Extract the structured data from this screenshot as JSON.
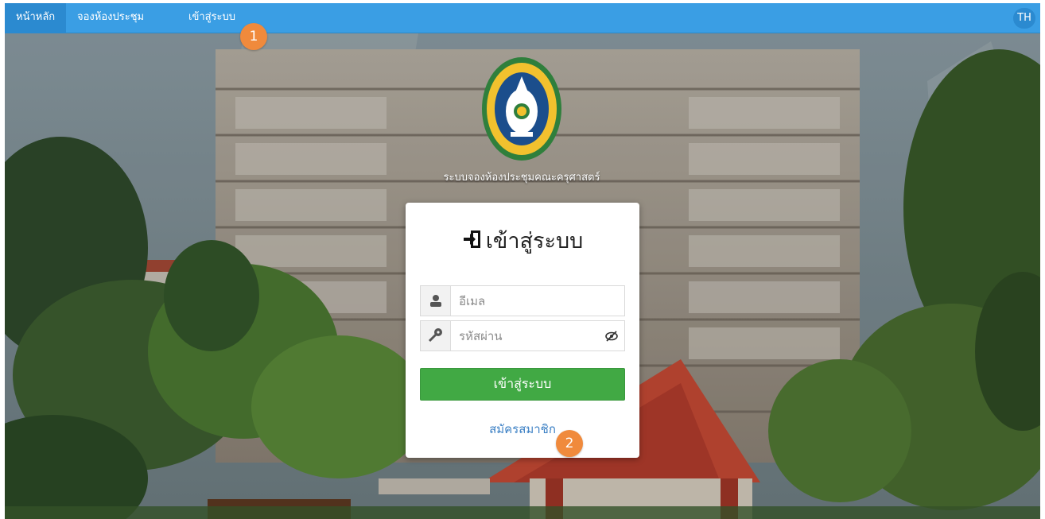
{
  "navbar": {
    "items": [
      {
        "label": "หน้าหลัก"
      },
      {
        "label": "จองห้องประชุม"
      },
      {
        "label": "เข้าสู่ระบบ"
      }
    ],
    "language": "TH"
  },
  "annotations": [
    {
      "number": "1"
    },
    {
      "number": "2"
    }
  ],
  "system_title": "ระบบจองห้องประชุมคณะครุศาสตร์",
  "login": {
    "title": "เข้าสู่ระบบ",
    "email_placeholder": "อีเมล",
    "password_placeholder": "รหัสผ่าน",
    "submit_label": "เข้าสู่ระบบ",
    "register_label": "สมัครสมาชิก"
  },
  "icons": {
    "user": "user-icon",
    "password": "key-icon",
    "toggle_password": "eye-slash-icon",
    "login": "sign-in-icon"
  },
  "colors": {
    "navbar": "#3a9ee4",
    "submit_button": "#41a944",
    "register_link": "#3a7fc4",
    "marker": "#f08a3c"
  }
}
